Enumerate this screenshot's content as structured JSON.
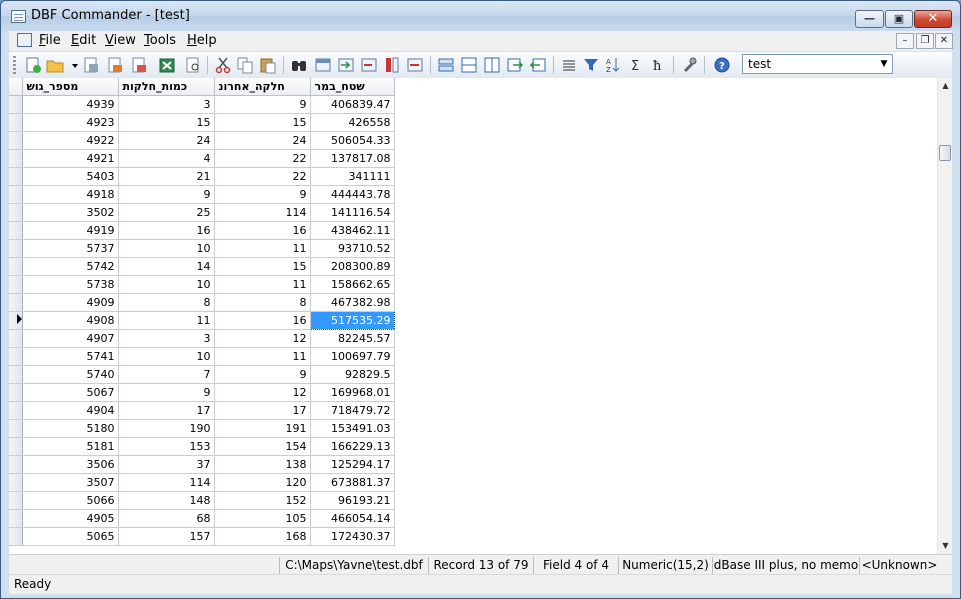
{
  "window": {
    "title": "DBF Commander - [test]"
  },
  "menu": [
    {
      "label": "File",
      "key": "F",
      "rest": "ile"
    },
    {
      "label": "Edit",
      "key": "E",
      "rest": "dit"
    },
    {
      "label": "View",
      "key": "V",
      "rest": "iew"
    },
    {
      "label": "Tools",
      "key": "T",
      "rest": "ools"
    },
    {
      "label": "Help",
      "key": "H",
      "rest": "elp"
    }
  ],
  "toolbar": {
    "table_select": "test"
  },
  "grid": {
    "columns": [
      "מספר_גוש",
      "כמות_חלקות",
      "חלקה_אחרונ",
      "שטח_במר"
    ],
    "rows": [
      [
        "4939",
        "3",
        "9",
        "406839.47"
      ],
      [
        "4923",
        "15",
        "15",
        "426558"
      ],
      [
        "4922",
        "24",
        "24",
        "506054.33"
      ],
      [
        "4921",
        "4",
        "22",
        "137817.08"
      ],
      [
        "5403",
        "21",
        "22",
        "341111"
      ],
      [
        "4918",
        "9",
        "9",
        "444443.78"
      ],
      [
        "3502",
        "25",
        "114",
        "141116.54"
      ],
      [
        "4919",
        "16",
        "16",
        "438462.11"
      ],
      [
        "5737",
        "10",
        "11",
        "93710.52"
      ],
      [
        "5742",
        "14",
        "15",
        "208300.89"
      ],
      [
        "5738",
        "10",
        "11",
        "158662.65"
      ],
      [
        "4909",
        "8",
        "8",
        "467382.98"
      ],
      [
        "4908",
        "11",
        "16",
        "517535.29"
      ],
      [
        "4907",
        "3",
        "12",
        "82245.57"
      ],
      [
        "5741",
        "10",
        "11",
        "100697.79"
      ],
      [
        "5740",
        "7",
        "9",
        "92829.5"
      ],
      [
        "5067",
        "9",
        "12",
        "169968.01"
      ],
      [
        "4904",
        "17",
        "17",
        "718479.72"
      ],
      [
        "5180",
        "190",
        "191",
        "153491.03"
      ],
      [
        "5181",
        "153",
        "154",
        "166229.13"
      ],
      [
        "3506",
        "37",
        "138",
        "125294.17"
      ],
      [
        "3507",
        "114",
        "120",
        "673881.37"
      ],
      [
        "5066",
        "148",
        "152",
        "96193.21"
      ],
      [
        "4905",
        "68",
        "105",
        "466054.14"
      ],
      [
        "5065",
        "157",
        "168",
        "172430.37"
      ]
    ],
    "current_row": 12,
    "selected_col": 3
  },
  "status": {
    "path": "C:\\Maps\\Yavne\\test.dbf",
    "record": "Record 13 of 79",
    "field": "Field 4 of 4",
    "type": "Numeric(15,2)",
    "format": "dBase III plus, no memo",
    "encoding": "<Unknown>",
    "ready": "Ready"
  },
  "colors": {
    "selection": "#3399ff",
    "close_button": "#c23d27"
  }
}
